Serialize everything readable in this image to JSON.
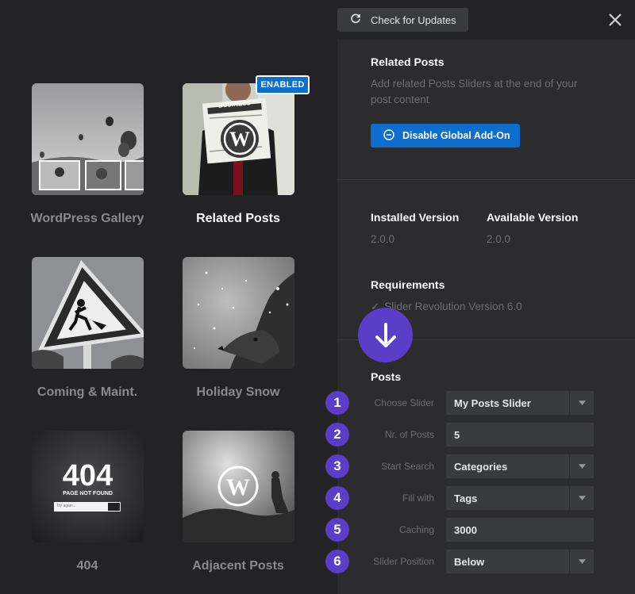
{
  "header": {
    "update_button": "Check for Updates"
  },
  "gallery": [
    {
      "title": "WordPress Gallery",
      "active": false
    },
    {
      "title": "Related Posts",
      "active": true,
      "badge": "ENABLED"
    },
    {
      "title": "Coming & Maint.",
      "active": false
    },
    {
      "title": "Holiday Snow",
      "active": false
    },
    {
      "title": "404",
      "active": false,
      "thumb_text": "404",
      "thumb_sub": "PAGE NOT FOUND"
    },
    {
      "title": "Adjacent Posts",
      "active": false
    }
  ],
  "thumb_texts": {
    "newspaper": "BUSINESS",
    "big404": "404",
    "sub404": "PAGE NOT FOUND",
    "search404": "Try again..."
  },
  "addon": {
    "name": "Related Posts",
    "description_line1": "Add related Posts Sliders at the end of your",
    "description_line2": "post content",
    "disable_button": "Disable Global Add-On"
  },
  "versions": {
    "installed_label": "Installed Version",
    "installed_value": "2.0.0",
    "available_label": "Available Version",
    "available_value": "2.0.0"
  },
  "requirements": {
    "label": "Requirements",
    "item": "Slider Revolution Version  6.0"
  },
  "posts": {
    "label": "Posts",
    "fields": [
      {
        "num": "1",
        "label": "Choose Slider",
        "value": "My Posts Slider",
        "type": "select"
      },
      {
        "num": "2",
        "label": "Nr. of Posts",
        "value": "5",
        "type": "input"
      },
      {
        "num": "3",
        "label": "Start Search",
        "value": "Categories",
        "type": "select"
      },
      {
        "num": "4",
        "label": "Fill with",
        "value": "Tags",
        "type": "select"
      },
      {
        "num": "5",
        "label": "Caching",
        "value": "3000",
        "type": "input"
      },
      {
        "num": "6",
        "label": "Slider Position",
        "value": "Below",
        "type": "select"
      }
    ]
  },
  "colors": {
    "accent_blue": "#0d6ecd",
    "accent_purple": "#5a3ec8",
    "panel": "#2c2c2f",
    "background": "#232326"
  }
}
